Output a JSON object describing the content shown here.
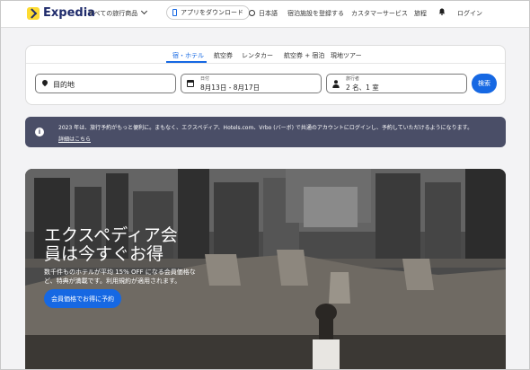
{
  "header": {
    "logo_text": "Expedia",
    "all_travel": "すべての旅行商品",
    "app_download": "アプリをダウンロード",
    "language": "日本語",
    "register_property": "宿泊施設を登録する",
    "customer_service": "カスタマーサービス",
    "trips": "旅程",
    "login": "ログイン"
  },
  "search": {
    "tabs": [
      {
        "label": "宿・ホテル",
        "active": true
      },
      {
        "label": "航空券",
        "active": false
      },
      {
        "label": "レンタカー",
        "active": false
      },
      {
        "label": "航空券 + 宿泊",
        "active": false
      },
      {
        "label": "現地ツアー",
        "active": false
      }
    ],
    "destination_placeholder": "目的地",
    "dates_label": "日付",
    "dates_value": "8月13日 - 8月17日",
    "travelers_label": "旅行者",
    "travelers_value": "2 名、1 室",
    "search_button": "検索"
  },
  "banner": {
    "text": "2023 年は、旅行予約がもっと便利に。まもなく、エクスペディア、Hotels.com、Vrbo (バーボ) で共通のアカウントにログインし、予約していただけるようになります。",
    "link": "詳細はこちら"
  },
  "hero": {
    "title_line1": "エクスペディア会",
    "title_line2": "員は今すぐお得",
    "subtitle": "数千件ものホテルが平均 15% OFF になる会員価格など、特典が満載です。利用規約が適用されます。",
    "button": "会員価格でお得に予約"
  },
  "colors": {
    "accent": "#1668e3",
    "brand_navy": "#1f2b6b",
    "brand_yellow": "#fddb32",
    "banner_bg": "#4a4e67"
  }
}
